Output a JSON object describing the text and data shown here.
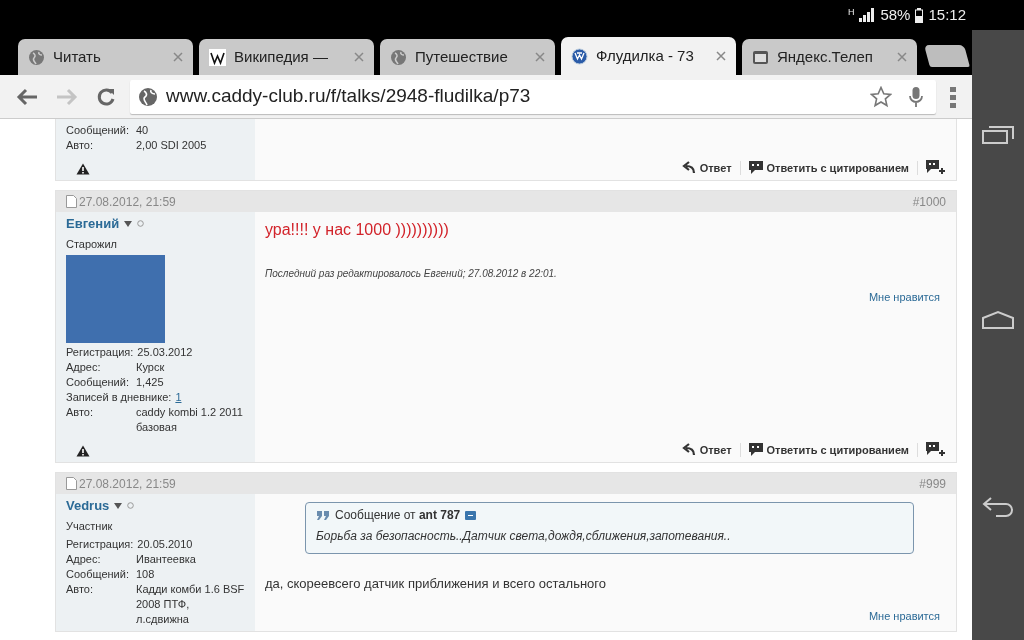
{
  "status_bar": {
    "network": "H",
    "battery": "58%",
    "time": "15:12"
  },
  "tabs": [
    {
      "title": "Читать",
      "selected": false
    },
    {
      "title": "Википедия —",
      "selected": false
    },
    {
      "title": "Путешествие",
      "selected": false
    },
    {
      "title": "Флудилка - 73",
      "selected": true
    },
    {
      "title": "Яндекс.Телеп",
      "selected": false
    }
  ],
  "toolbar": {
    "url": "www.caddy-club.ru/f/talks/2948-fludilka/p73",
    "forward_disabled": true
  },
  "posts": [
    {
      "fields": [
        {
          "label": "Сообщений:",
          "value": "40",
          "link": false
        },
        {
          "label": "Авто:",
          "value": "2,00 SDI 2005",
          "link": false
        }
      ],
      "actions": {
        "reply": "Ответ",
        "quote": "Ответить с цитированием"
      }
    },
    {
      "date": "27.08.2012, 21:59",
      "number": "#1000",
      "user": "Евгений",
      "rank": "Старожил",
      "avatar": true,
      "fields": [
        {
          "label": "Регистрация:",
          "value": "25.03.2012",
          "link": false
        },
        {
          "label": "Адрес:",
          "value": "Курск",
          "link": false
        },
        {
          "label": "Сообщений:",
          "value": "1,425",
          "link": false
        },
        {
          "label": "Записей в дневнике:",
          "value": "1",
          "link": true
        },
        {
          "label": "Авто:",
          "value": "caddy kombi 1.2 2011 базовая",
          "link": false
        }
      ],
      "message": "ура!!!! у нас 1000 ))))))))))",
      "kind": "highlight",
      "edit_note": "Последний раз редактировалось Евгений; 27.08.2012 в 22:01.",
      "like": "Мне нравится",
      "actions": {
        "reply": "Ответ",
        "quote": "Ответить с цитированием"
      }
    },
    {
      "date": "27.08.2012, 21:59",
      "number": "#999",
      "user": "Vedrus",
      "rank": "Участник",
      "fields": [
        {
          "label": "Регистрация:",
          "value": "20.05.2010",
          "link": false
        },
        {
          "label": "Адрес:",
          "value": "Ивантеевка",
          "link": false
        },
        {
          "label": "Сообщений:",
          "value": "108",
          "link": false
        },
        {
          "label": "Авто:",
          "value": "Кадди комби 1.6 BSF 2008 ПТФ, л.сдвижна",
          "link": false
        }
      ],
      "quote": {
        "header": "Сообщение от **ant 787**",
        "text": "Борьба за безопасность..Датчик света,дождя,сближения,запотевания.."
      },
      "message": "да, скореевсего датчик приближения и всего остального",
      "kind": "plain",
      "like": "Мне нравится"
    }
  ]
}
